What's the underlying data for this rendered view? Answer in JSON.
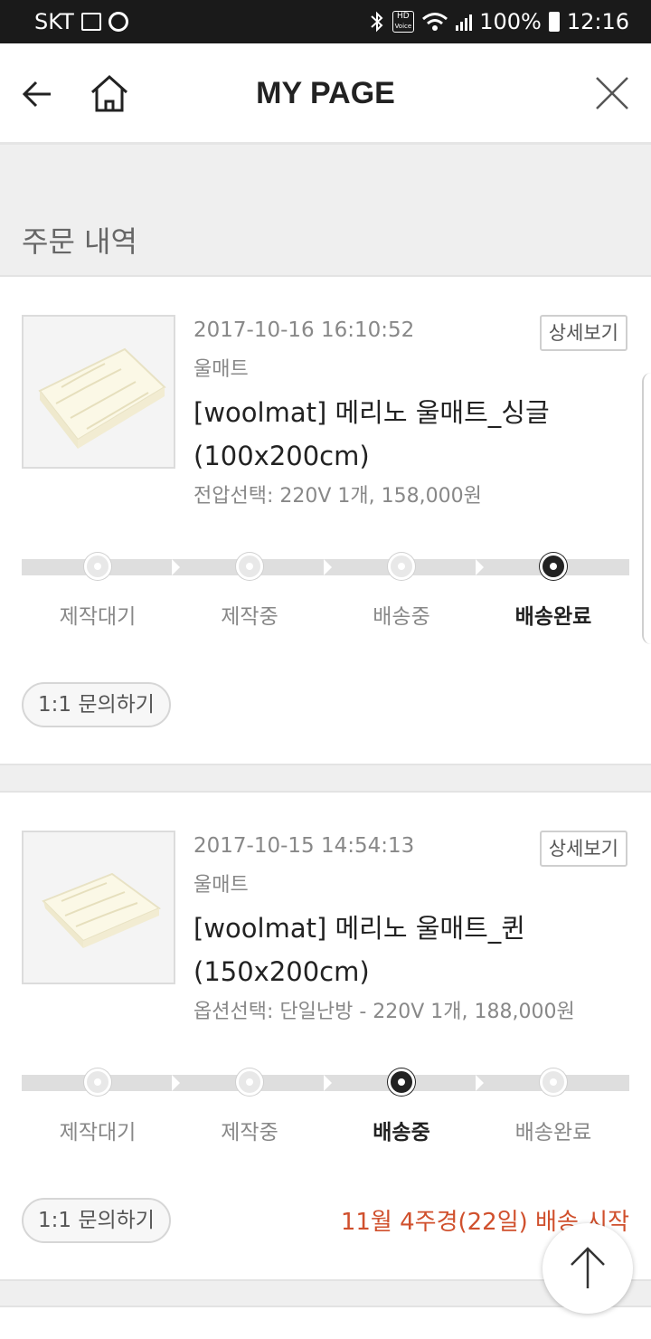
{
  "status_bar": {
    "carrier": "SKT",
    "hd_label": "HD",
    "voice_label": "Voice",
    "battery": "100%",
    "time": "12:16"
  },
  "header": {
    "title": "MY PAGE"
  },
  "section": {
    "title": "주문 내역"
  },
  "orders": [
    {
      "date": "2017-10-16 16:10:52",
      "category": "울매트",
      "name_line1": "[woolmat] 메리노 울매트_싱글",
      "name_line2": "(100x200cm)",
      "option": "전압선택: 220V 1개, 158,000원",
      "detail_label": "상세보기",
      "steps": [
        "제작대기",
        "제작중",
        "배송중",
        "배송완료"
      ],
      "active_step": 3,
      "inquiry_label": "1:1 문의하기",
      "shipping_note": ""
    },
    {
      "date": "2017-10-15 14:54:13",
      "category": "울매트",
      "name_line1": "[woolmat] 메리노 울매트_퀸",
      "name_line2": "(150x200cm)",
      "option": "옵션선택: 단일난방 - 220V 1개, 188,000원",
      "detail_label": "상세보기",
      "steps": [
        "제작대기",
        "제작중",
        "배송중",
        "배송완료"
      ],
      "active_step": 2,
      "inquiry_label": "1:1 문의하기",
      "shipping_note": "11월 4주경(22일) 배송 시작"
    }
  ],
  "icons": {
    "back": "arrow-left-icon",
    "home": "home-icon",
    "close": "close-icon",
    "scroll_top": "arrow-up-icon"
  },
  "colors": {
    "accent_red": "#d0502d",
    "active_dot": "#222222"
  }
}
